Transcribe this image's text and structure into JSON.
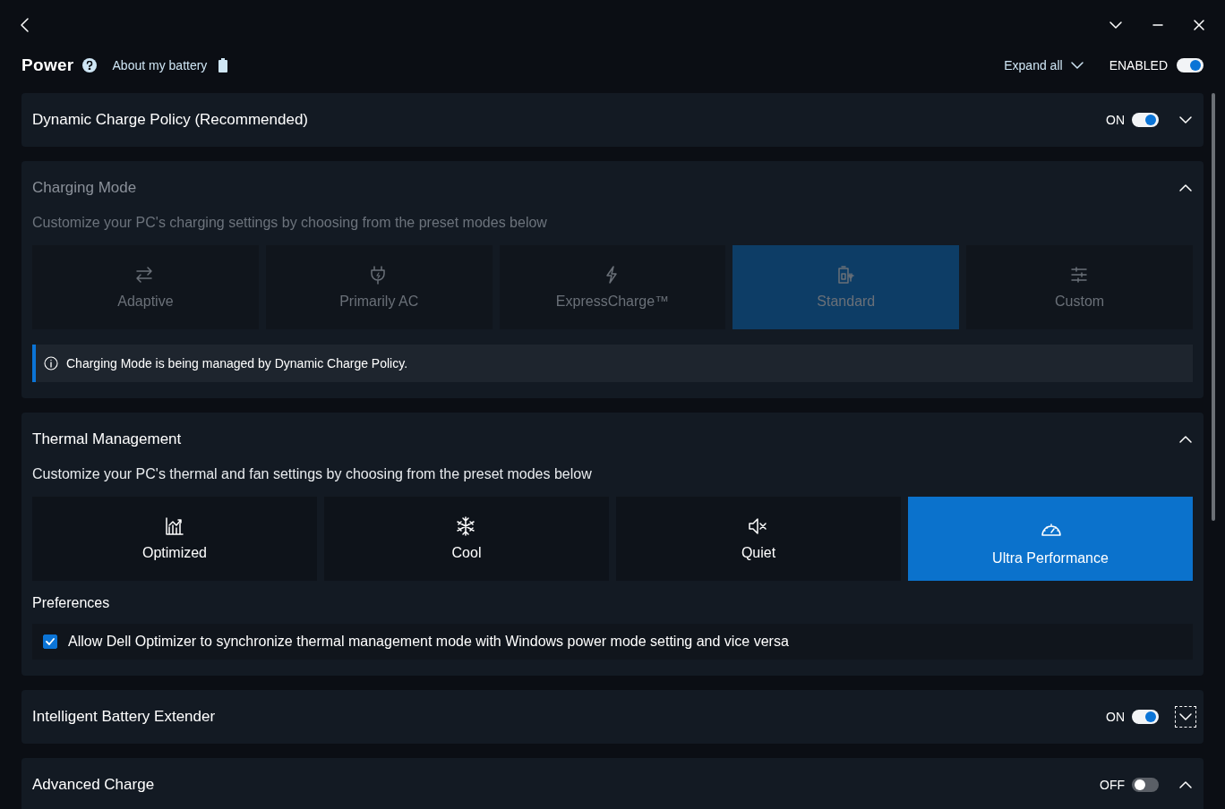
{
  "header": {
    "title": "Power",
    "battery_link": "About my battery",
    "expand_all": "Expand all",
    "enabled_label": "ENABLED",
    "enabled_on": true
  },
  "sections": [
    {
      "kind": "toggle",
      "title": "Dynamic Charge Policy (Recommended)",
      "toggle_label": "ON",
      "on": true,
      "expanded": false,
      "focused": false
    },
    {
      "kind": "charging",
      "title": "Charging Mode",
      "disabled": true,
      "expanded": true,
      "description": "Customize your PC's charging settings by choosing from the preset modes below",
      "modes": [
        {
          "label": "Adaptive",
          "selected": false
        },
        {
          "label": "Primarily AC",
          "selected": false
        },
        {
          "label": "ExpressCharge™",
          "selected": false
        },
        {
          "label": "Standard",
          "selected": true
        },
        {
          "label": "Custom",
          "selected": false
        }
      ],
      "note": "Charging Mode is being managed by Dynamic Charge Policy."
    },
    {
      "kind": "thermal",
      "title": "Thermal Management",
      "disabled": false,
      "expanded": true,
      "description": "Customize your PC's thermal and fan settings by choosing from the preset modes below",
      "modes": [
        {
          "label": "Optimized",
          "selected": false
        },
        {
          "label": "Cool",
          "selected": false
        },
        {
          "label": "Quiet",
          "selected": false
        },
        {
          "label": "Ultra Performance",
          "selected": true
        }
      ],
      "preferences_title": "Preferences",
      "preference": {
        "label": "Allow Dell Optimizer to synchronize thermal management mode with Windows power mode setting and vice versa",
        "checked": true
      }
    },
    {
      "kind": "toggle",
      "title": "Intelligent Battery Extender",
      "toggle_label": "ON",
      "on": true,
      "expanded": false,
      "focused": true
    },
    {
      "kind": "toggle",
      "title": "Advanced Charge",
      "toggle_label": "OFF",
      "on": false,
      "expanded": true,
      "focused": false
    }
  ]
}
